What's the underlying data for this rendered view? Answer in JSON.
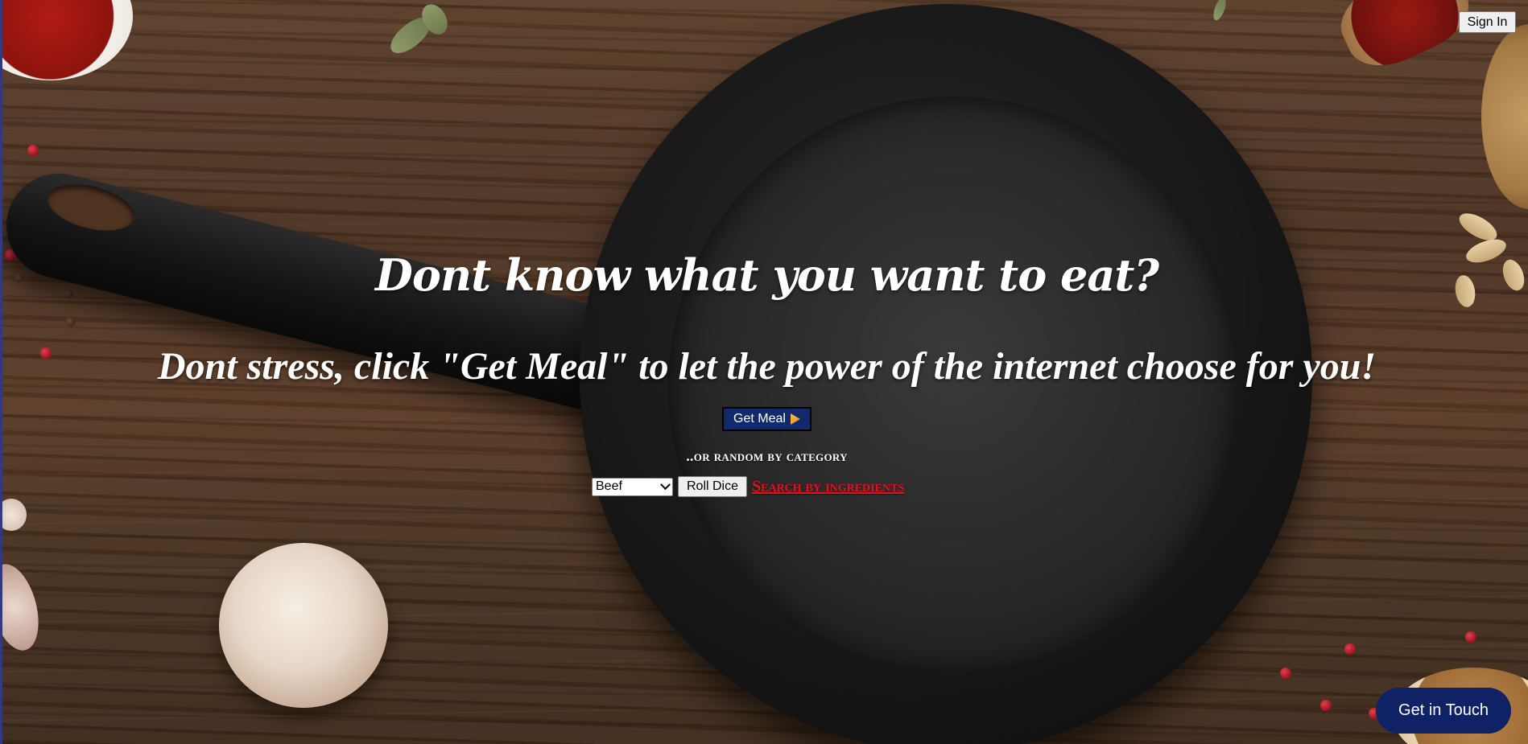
{
  "header": {
    "sign_in_label": "Sign In"
  },
  "hero": {
    "headline": "Dont know what you want to eat?",
    "subheadline": "Dont stress, click \"Get Meal\" to let the power of the internet choose for you!",
    "get_meal_label": "Get Meal",
    "get_meal_icon": "pizza-icon",
    "or_random_label": "..or random by category",
    "category_select": {
      "selected": "Beef"
    },
    "roll_dice_label": "Roll Dice",
    "search_ingredients_label": "Search by ingredients"
  },
  "footer": {
    "get_in_touch_label": "Get in Touch"
  },
  "colors": {
    "primary_button": "#102a6b",
    "contact_button": "#0f2266",
    "link": "#e0141d",
    "text": "#ffffff"
  }
}
